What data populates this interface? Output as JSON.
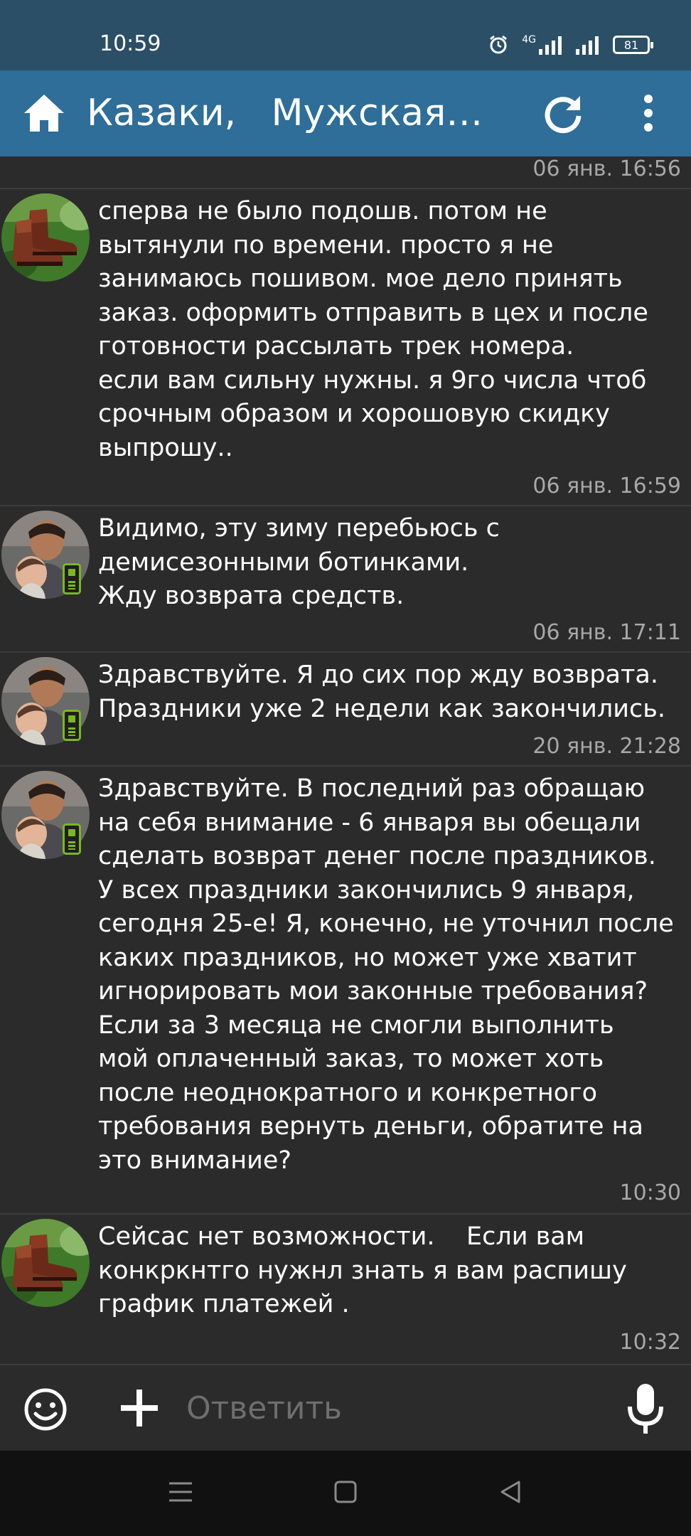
{
  "status_bar": {
    "time": "10:59",
    "network": "4G",
    "battery": "81"
  },
  "app_bar": {
    "title": "Казаки,   Мужская о...",
    "icons": [
      "home-icon",
      "refresh-icon",
      "more-vert-icon"
    ]
  },
  "chat": {
    "previous_time": "06 янв. 16:56",
    "messages": [
      {
        "sender": "seller",
        "avatar": "boots-avatar",
        "text": "сперва не было подошв. потом не\nвытянули по времени. просто я не\nзанимаюсь пошивом. мое дело принять\nзаказ. оформить отправить в цех и после\nготовности рассылать трек номера.\nесли вам сильну нужны. я 9го числа чтоб\nсрочным образом и хорошовую скидку\nвыпрошу..",
        "time": "06 янв. 16:59"
      },
      {
        "sender": "buyer",
        "avatar": "man-child-avatar",
        "mobile": true,
        "text": "Видимо, эту зиму перебьюсь с\nдемисезонными ботинками.\nЖду возврата средств.",
        "time": "06 янв. 17:11"
      },
      {
        "sender": "buyer",
        "avatar": "man-child-avatar",
        "mobile": true,
        "text": "Здравствуйте. Я до сих пор жду возврата.\nПраздники уже 2 недели как закончились.",
        "time": "20 янв. 21:28"
      },
      {
        "sender": "buyer",
        "avatar": "man-child-avatar",
        "mobile": true,
        "text": "Здравствуйте. В последний раз обращаю\nна себя внимание - 6 января вы обещали\nсделать возврат денег после праздников.\nУ всех праздники закончились 9 января,\nсегодня 25-е! Я, конечно, не уточнил после\nкаких праздников, но может уже хватит\nигнорировать мои законные требования?\nЕсли за 3 месяца не смогли выполнить\nмой оплаченный заказ, то может хоть\nпосле неоднократного и конкретного\nтребования вернуть деньги, обратите на\nэто внимание?",
        "time": "10:30"
      },
      {
        "sender": "seller",
        "avatar": "boots-avatar",
        "text": "Сейсас нет возможности.    Если вам\nконкркнтго нужнл знать я вам распишу\nграфик платежей .",
        "time": "10:32"
      }
    ]
  },
  "input_bar": {
    "placeholder": "Ответить",
    "icons": [
      "smile-icon",
      "plus-icon",
      "mic-icon"
    ]
  },
  "nav_bar": {
    "icons": [
      "menu-nav-icon",
      "home-nav-icon",
      "back-nav-icon"
    ]
  },
  "colors": {
    "status_bar": "#2b4f67",
    "app_bar": "#2e6e98",
    "background": "#2b2b2b",
    "timestamp": "#a8a8a8",
    "mobile_badge": "#7ab81e"
  }
}
